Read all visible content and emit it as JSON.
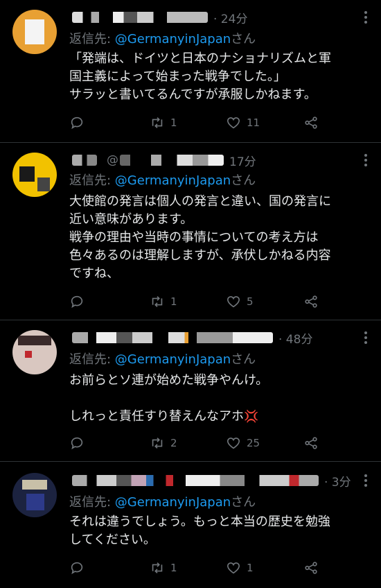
{
  "tweets": [
    {
      "time": "· 24分",
      "reply_prefix": "返信先: ",
      "reply_handle": "@GermanyinJapan",
      "reply_suffix": "さん",
      "body": "「発端は、ドイツと日本のナショナリズムと軍\n国主義によって始まった戦争でした。」\nサラッと書いてるんですが承服しかねます。",
      "retweets": "1",
      "likes": "11"
    },
    {
      "time": "17分",
      "handle_fragment": "@",
      "reply_prefix": "返信先: ",
      "reply_handle": "@GermanyinJapan",
      "reply_suffix": "さん",
      "body": "大使館の発言は個人の発言と違い、国の発言に\n近い意味があります。\n戦争の理由や当時の事情についての考え方は\n色々あるのは理解しますが、承伏しかねる内容\nですね、",
      "retweets": "1",
      "likes": "5"
    },
    {
      "time": "· 48分",
      "reply_prefix": "返信先: ",
      "reply_handle": "@GermanyinJapan",
      "reply_suffix": "さん",
      "body": "お前らとソ連が始めた戦争やんけ。\n\nしれっと責任すり替えんなアホ",
      "emoji": "💢",
      "retweets": "2",
      "likes": "25"
    },
    {
      "time": "· 3分",
      "reply_prefix": "返信先: ",
      "reply_handle": "@GermanyinJapan",
      "reply_suffix": "さん",
      "body": "それは違うでしょう。もっと本当の歴史を勉強\nしてください。",
      "retweets": "1",
      "likes": "1"
    }
  ],
  "icons": [
    "reply-icon",
    "retweet-icon",
    "like-icon",
    "share-icon",
    "more-icon"
  ],
  "colors": {
    "link": "#1d9bf0",
    "muted": "#71767b",
    "text": "#e7e9ea",
    "background": "#000000"
  }
}
